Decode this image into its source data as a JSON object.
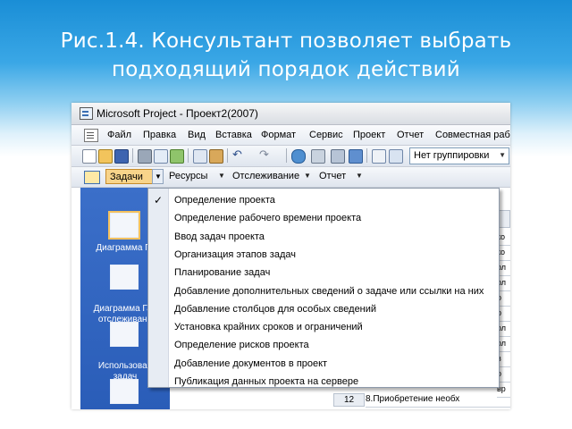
{
  "slide": {
    "title_line1": "Рис.1.4. Консультант позволяет выбрать",
    "title_line2": "подходящий порядок действий"
  },
  "window": {
    "title": "Microsoft Project - Проект2(2007)",
    "menu": [
      "Файл",
      "Правка",
      "Вид",
      "Вставка",
      "Формат",
      "Сервис",
      "Проект",
      "Отчет",
      "Совместная рабо"
    ],
    "group_select_value": "Нет группировки",
    "toolbar2": {
      "tasks": "Задачи",
      "resources": "Ресурсы",
      "tracking": "Отслеживание",
      "report": "Отчет"
    }
  },
  "sidebar": {
    "items": [
      {
        "label": "Диаграмма Га",
        "icon": "gantt-chart-icon"
      },
      {
        "label": "Диаграмма Ган\nотслеживани",
        "icon": "tracking-gantt-icon"
      },
      {
        "label": "Использован\nзадач",
        "icon": "task-usage-icon"
      },
      {
        "label": "",
        "icon": "calendar-icon"
      }
    ]
  },
  "dropdown": {
    "items": [
      {
        "label": "Определение проекта",
        "checked": true
      },
      {
        "label": "Определение рабочего времени проекта",
        "checked": false
      },
      {
        "label": "Ввод задач проекта",
        "checked": false
      },
      {
        "label": "Организация этапов задач",
        "checked": false
      },
      {
        "label": "Планирование задач",
        "checked": false
      },
      {
        "label": "Добавление дополнительных сведений о задаче или ссылки на них",
        "checked": false
      },
      {
        "label": "Добавление столбцов для особых сведений",
        "checked": false
      },
      {
        "label": "Установка крайних сроков и ограничений",
        "checked": false
      },
      {
        "label": "Определение рисков проекта",
        "checked": false
      },
      {
        "label": "Добавление документов в проект",
        "checked": false
      },
      {
        "label": "Публикация данных проекта на сервере",
        "checked": false
      }
    ]
  },
  "sheet": {
    "row_number": "12",
    "row_task": "8.Приобретение необх",
    "right_fragments": [
      "ко",
      "ко",
      "ол",
      "ол",
      "о",
      "р",
      "ол",
      "ол",
      "в",
      "о",
      "вр"
    ]
  },
  "colors": {
    "sidebar": "#3b6fc9",
    "active_tab": "#f8d48a",
    "slide_header": "#1a8ed6"
  }
}
